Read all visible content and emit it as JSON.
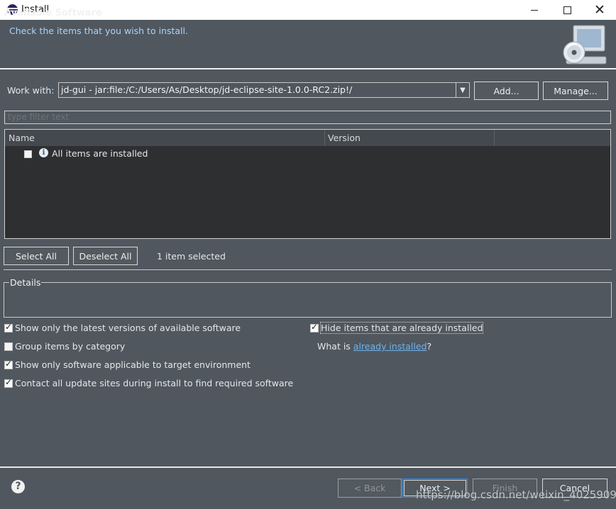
{
  "window": {
    "title": "Install",
    "controls": {
      "minimize": "minimize",
      "maximize": "maximize",
      "close": "✕"
    }
  },
  "banner": {
    "title": "Available Software",
    "description": "Check the items that you wish to install.",
    "icon": "computer-cd-icon"
  },
  "work_with": {
    "label": "Work with:",
    "value": "jd-gui - jar:file:/C:/Users/As/Desktop/jd-eclipse-site-1.0.0-RC2.zip!/",
    "add_label": "Add...",
    "manage_label": "Manage..."
  },
  "filter": {
    "placeholder": "type filter text"
  },
  "tree": {
    "columns": [
      "Name",
      "Version"
    ],
    "rows": [
      {
        "label": "All items are installed",
        "checked": false,
        "icon": "info-icon"
      }
    ]
  },
  "selection": {
    "select_all_label": "Select All",
    "deselect_all_label": "Deselect All",
    "count_text": "1 item selected"
  },
  "details": {
    "label": "Details"
  },
  "options": {
    "latest_versions": {
      "label": "Show only the latest versions of available software",
      "checked": true
    },
    "group_by_category": {
      "label": "Group items by category",
      "checked": false
    },
    "target_environment": {
      "label": "Show only software applicable to target environment",
      "checked": true
    },
    "contact_sites": {
      "label": "Contact all update sites during install to find required software",
      "checked": true
    },
    "hide_installed": {
      "label": "Hide items that are already installed",
      "checked": true
    },
    "what_is": {
      "prefix": "What is ",
      "link": "already installed",
      "suffix": "?"
    }
  },
  "footer": {
    "back_label": "< Back",
    "next_label": "Next >",
    "finish_label": "Finish",
    "cancel_label": "Cancel",
    "help_icon": "help-icon"
  },
  "watermark": "https://blog.csdn.net/weixin_40259093",
  "colors": {
    "background": "#50575e",
    "tree_background": "#2d2f31",
    "link": "#6fb3ee",
    "description": "#a8d4ff"
  }
}
